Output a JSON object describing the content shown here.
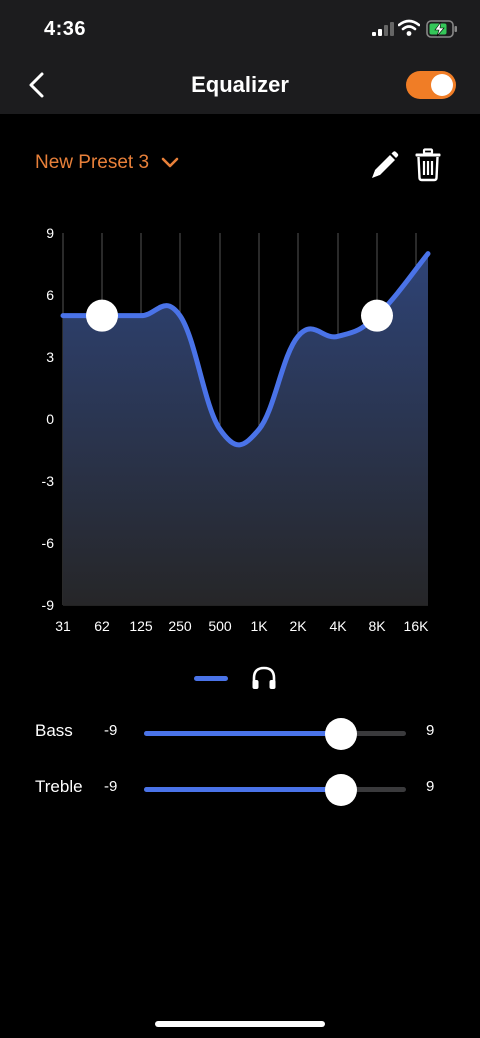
{
  "status": {
    "time": "4:36"
  },
  "nav": {
    "title": "Equalizer",
    "toggle_on": true
  },
  "preset": {
    "name": "New Preset 3"
  },
  "chart_data": {
    "type": "line",
    "x": [
      "31",
      "62",
      "125",
      "250",
      "500",
      "1K",
      "2K",
      "4K",
      "8K",
      "16K"
    ],
    "ylim": [
      -9,
      9
    ],
    "y_ticks": [
      "9",
      "6",
      "3",
      "0",
      "-3",
      "-6",
      "-9"
    ],
    "series": [
      {
        "values": [
          5,
          5,
          5,
          5,
          -0.5,
          -0.5,
          4,
          4,
          5,
          8
        ],
        "color": "#4a73e8"
      }
    ],
    "control_points": [
      1,
      8
    ],
    "grid": true
  },
  "sliders": {
    "bass": {
      "label": "Bass",
      "min_label": "-9",
      "max_label": "9",
      "value": 4.5
    },
    "treble": {
      "label": "Treble",
      "min_label": "-9",
      "max_label": "9",
      "value": 4.5
    }
  },
  "colors": {
    "accent": "#e8803a",
    "toggle": "#f07d26",
    "curve": "#4a73e8"
  }
}
